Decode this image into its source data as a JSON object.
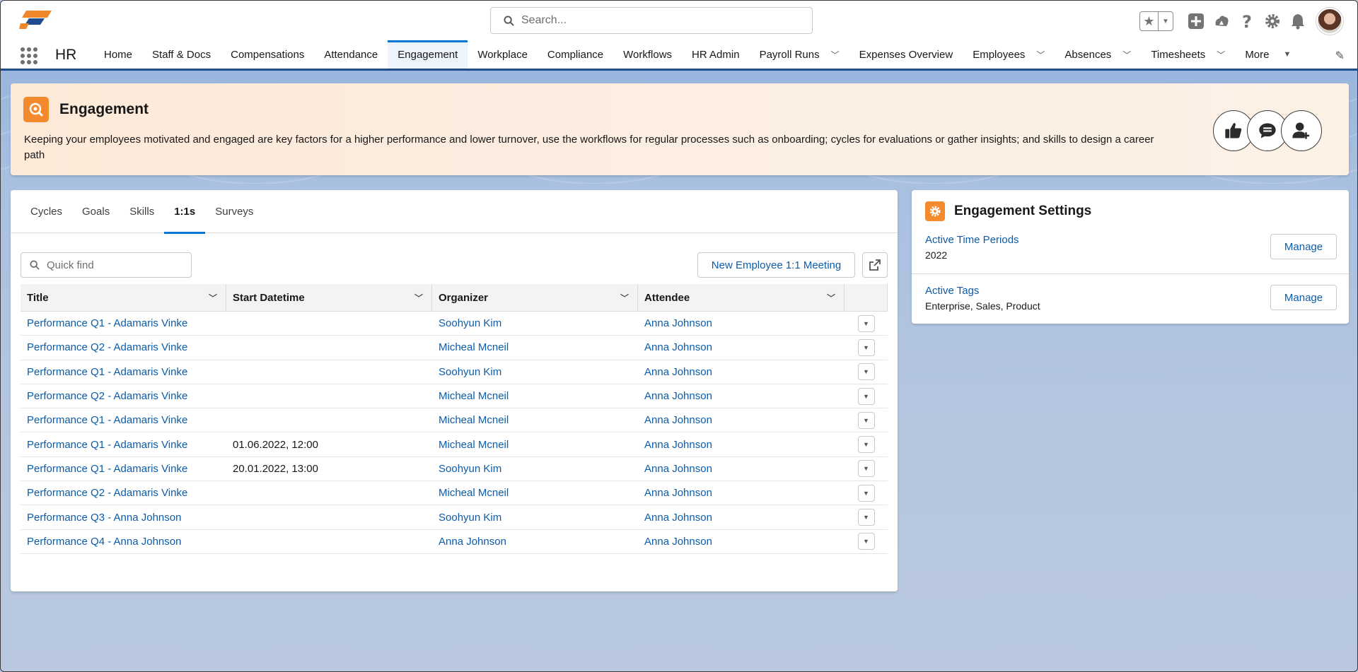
{
  "header": {
    "search_placeholder": "Search...",
    "icons": [
      "favorites-star-icon",
      "add-icon",
      "trailhead-icon",
      "help-icon",
      "setup-gear-icon",
      "notifications-bell-icon",
      "user-avatar"
    ]
  },
  "nav": {
    "app_name": "HR",
    "items": [
      {
        "label": "Home"
      },
      {
        "label": "Staff & Docs"
      },
      {
        "label": "Compensations"
      },
      {
        "label": "Attendance"
      },
      {
        "label": "Engagement",
        "active": true
      },
      {
        "label": "Workplace"
      },
      {
        "label": "Compliance"
      },
      {
        "label": "Workflows"
      },
      {
        "label": "HR Admin"
      },
      {
        "label": "Payroll Runs",
        "dropdown": true
      },
      {
        "label": "Expenses Overview"
      },
      {
        "label": "Employees",
        "dropdown": true
      },
      {
        "label": "Absences",
        "dropdown": true
      },
      {
        "label": "Timesheets",
        "dropdown": true
      },
      {
        "label": "More",
        "dropdown": true
      }
    ]
  },
  "banner": {
    "title": "Engagement",
    "description": "Keeping your employees motivated and engaged are key factors for a higher performance and lower turnover, use the workflows for regular processes such as onboarding; cycles for evaluations or gather insights; and skills to design a career path",
    "action_icons": [
      "thumbs-up-icon",
      "chat-icon",
      "user-add-icon"
    ]
  },
  "tabs": [
    "Cycles",
    "Goals",
    "Skills",
    "1:1s",
    "Surveys"
  ],
  "active_tab": "1:1s",
  "list": {
    "quickfind_placeholder": "Quick find",
    "new_button": "New Employee 1:1 Meeting",
    "columns": [
      "Title",
      "Start Datetime",
      "Organizer",
      "Attendee"
    ],
    "rows": [
      {
        "title": "Performance Q1 - Adamaris Vinke",
        "start": "",
        "organizer": "Soohyun Kim",
        "attendee": "Anna Johnson"
      },
      {
        "title": "Performance Q2 - Adamaris Vinke",
        "start": "",
        "organizer": "Micheal Mcneil",
        "attendee": "Anna Johnson"
      },
      {
        "title": "Performance Q1 - Adamaris Vinke",
        "start": "",
        "organizer": "Soohyun Kim",
        "attendee": "Anna Johnson"
      },
      {
        "title": "Performance Q2 - Adamaris Vinke",
        "start": "",
        "organizer": "Micheal Mcneil",
        "attendee": "Anna Johnson"
      },
      {
        "title": "Performance Q1 - Adamaris Vinke",
        "start": "",
        "organizer": "Micheal Mcneil",
        "attendee": "Anna Johnson"
      },
      {
        "title": "Performance Q1 - Adamaris Vinke",
        "start": "01.06.2022, 12:00",
        "organizer": "Micheal Mcneil",
        "attendee": "Anna Johnson"
      },
      {
        "title": "Performance Q1 - Adamaris Vinke",
        "start": "20.01.2022, 13:00",
        "organizer": "Soohyun Kim",
        "attendee": "Anna Johnson"
      },
      {
        "title": "Performance Q2 - Adamaris Vinke",
        "start": "",
        "organizer": "Micheal Mcneil",
        "attendee": "Anna Johnson"
      },
      {
        "title": "Performance Q3 - Anna Johnson",
        "start": "",
        "organizer": "Soohyun Kim",
        "attendee": "Anna Johnson"
      },
      {
        "title": "Performance Q4 - Anna Johnson",
        "start": "",
        "organizer": "Anna Johnson",
        "attendee": "Anna Johnson"
      }
    ]
  },
  "settings": {
    "title": "Engagement Settings",
    "items": [
      {
        "label": "Active Time Periods",
        "value": "2022",
        "button": "Manage"
      },
      {
        "label": "Active Tags",
        "value": "Enterprise, Sales, Product",
        "button": "Manage"
      }
    ]
  },
  "colors": {
    "accent": "#0176d3",
    "link": "#0b5cab",
    "brand_orange": "#f38b2e",
    "nav_border": "#1f4b8f"
  }
}
